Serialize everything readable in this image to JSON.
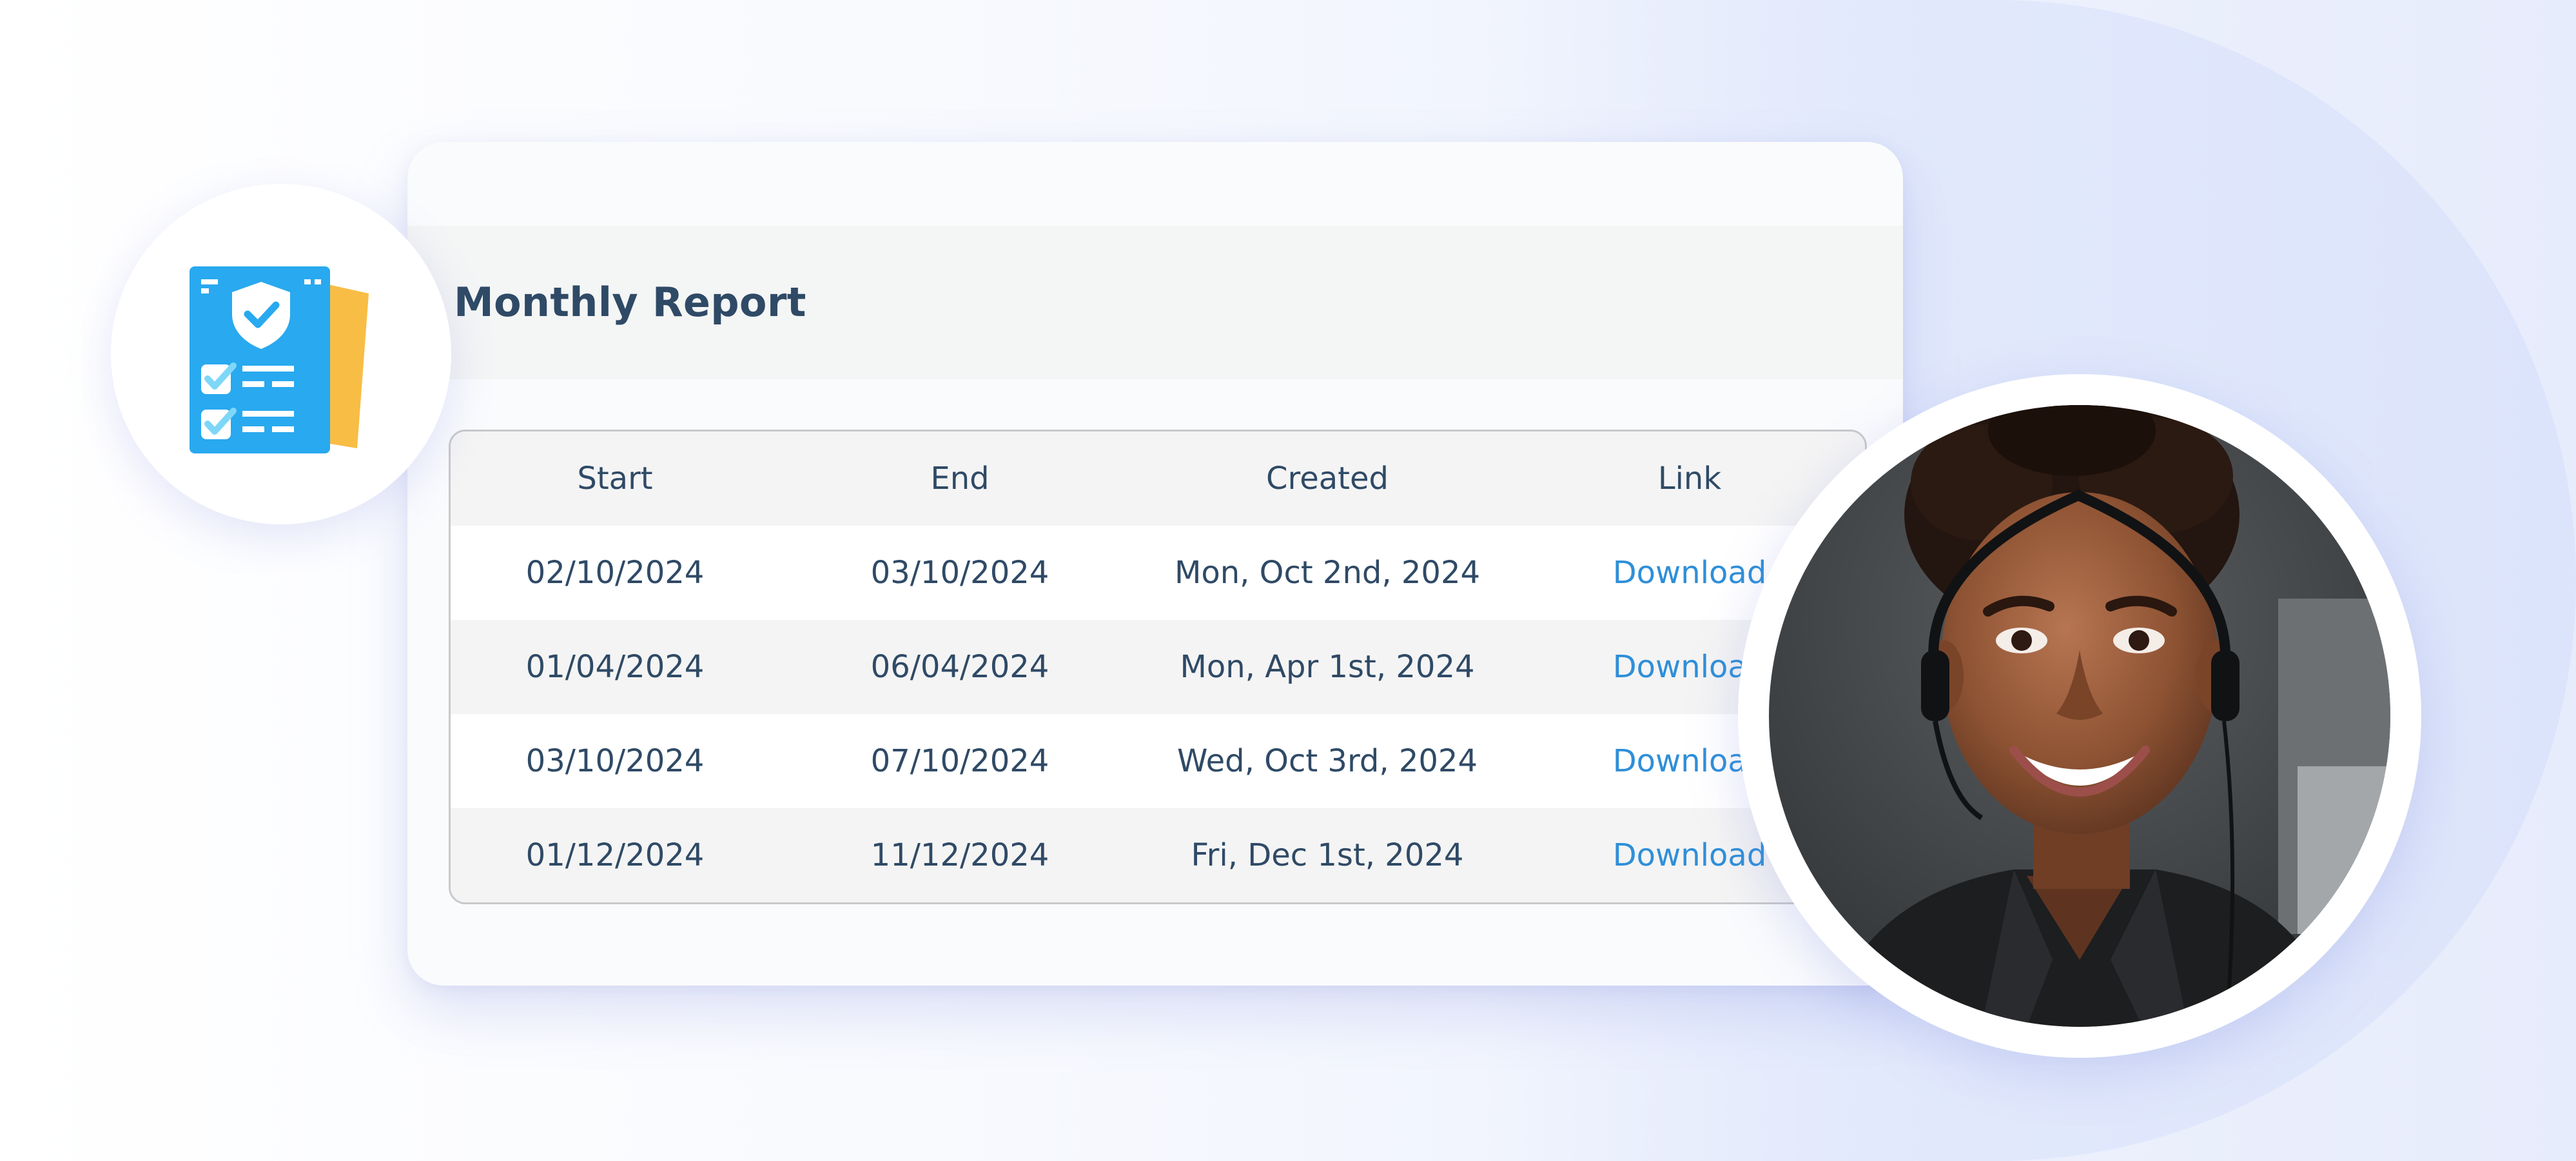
{
  "report": {
    "title": "Monthly Report",
    "columns": [
      "Start",
      "End",
      "Created",
      "Link"
    ],
    "rows": [
      {
        "start": "02/10/2024",
        "end": "03/10/2024",
        "created": "Mon, Oct 2nd, 2024",
        "link": "Download"
      },
      {
        "start": "01/04/2024",
        "end": "06/04/2024",
        "created": "Mon, Apr 1st, 2024",
        "link": "Download"
      },
      {
        "start": "03/10/2024",
        "end": "07/10/2024",
        "created": "Wed, Oct 3rd, 2024",
        "link": "Download"
      },
      {
        "start": "01/12/2024",
        "end": "11/12/2024",
        "created": "Fri, Dec 1st, 2024",
        "link": "Download"
      }
    ]
  },
  "icons": {
    "report_icon": "checklist-shield-icon"
  },
  "colors": {
    "title": "#2f4a66",
    "link": "#2f8fd8",
    "icon_blue": "#29a9ef",
    "icon_yellow": "#f8bd45"
  }
}
